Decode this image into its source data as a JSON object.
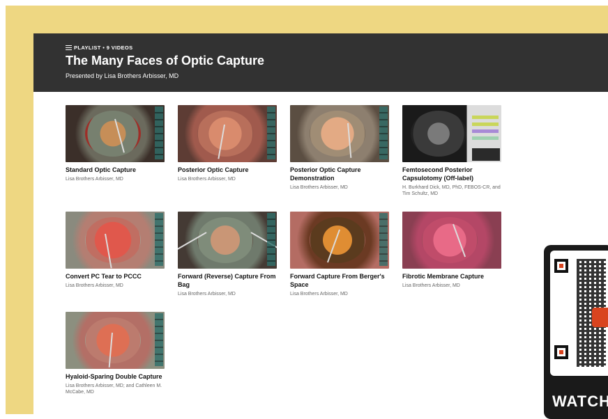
{
  "playlist": {
    "eyebrow": "PLAYLIST • 9 VIDEOS",
    "title": "The Many Faces of Optic Capture",
    "presenter": "Presented by Lisa Brothers Arbisser, MD"
  },
  "videos": [
    {
      "title": "Standard Optic Capture",
      "author": "Lisa Brothers Arbisser, MD"
    },
    {
      "title": "Posterior Optic Capture",
      "author": "Lisa Brothers Arbisser, MD"
    },
    {
      "title": "Posterior Optic Capture Demonstration",
      "author": "Lisa Brothers Arbisser, MD"
    },
    {
      "title": "Femtosecond Posterior Capsulotomy (Off-label)",
      "author": "H. Burkhard Dick, MD, PhD, FEBOS-CR, and Tim Schultz, MD"
    },
    {
      "title": "Convert PC Tear to PCCC",
      "author": "Lisa Brothers Arbisser, MD"
    },
    {
      "title": "Forward (Reverse) Capture From Bag",
      "author": "Lisa Brothers Arbisser, MD"
    },
    {
      "title": "Forward Capture From Berger's Space",
      "author": "Lisa Brothers Arbisser, MD"
    },
    {
      "title": "Fibrotic Membrane Capture",
      "author": "Lisa Brothers Arbisser, MD"
    },
    {
      "title": "Hyaloid-Sparing Double Capture",
      "author": "Lisa Brothers Arbisser, MD; and Cathleen M. McCabe, MD"
    }
  ],
  "qr": {
    "label": "WATCH",
    "accent": "#d9441f"
  },
  "colors": {
    "frame": "#eed782",
    "header": "#323232"
  },
  "icons": [
    "list-icon",
    "qr-code-icon"
  ]
}
